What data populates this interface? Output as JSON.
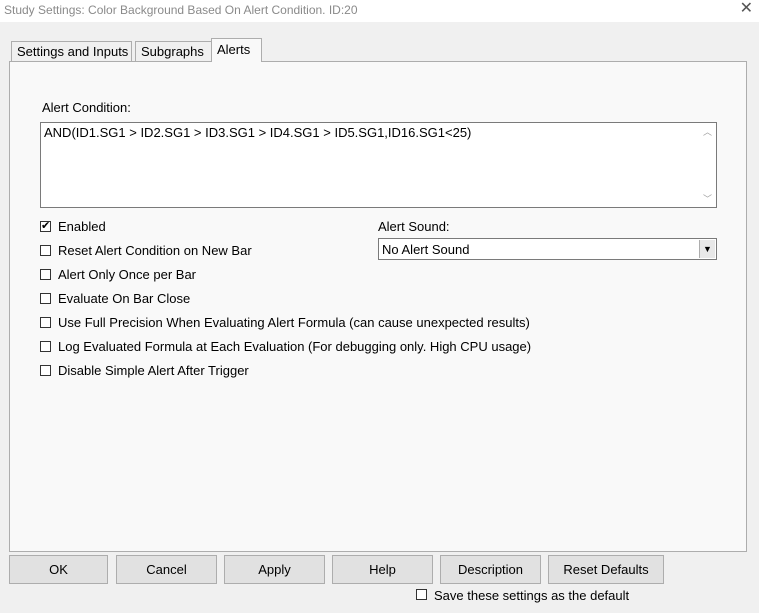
{
  "window": {
    "title": "Study Settings: Color Background Based On Alert Condition. ID:20"
  },
  "tabs": [
    {
      "label": "Settings and Inputs"
    },
    {
      "label": "Subgraphs"
    },
    {
      "label": "Alerts"
    }
  ],
  "alerts": {
    "condition_label": "Alert Condition:",
    "condition_value": "AND(ID1.SG1 > ID2.SG1 > ID3.SG1 > ID4.SG1 > ID5.SG1,ID16.SG1<25)",
    "checkboxes": [
      {
        "label": "Enabled",
        "checked": true
      },
      {
        "label": "Reset Alert Condition on New Bar",
        "checked": false
      },
      {
        "label": "Alert Only Once per Bar",
        "checked": false
      },
      {
        "label": "Evaluate On Bar Close",
        "checked": false
      },
      {
        "label": "Use Full Precision When Evaluating Alert Formula (can cause unexpected results)",
        "checked": false
      },
      {
        "label": "Log Evaluated Formula at Each Evaluation (For debugging only. High CPU usage)",
        "checked": false
      },
      {
        "label": "Disable Simple Alert After Trigger",
        "checked": false
      }
    ],
    "sound_label": "Alert Sound:",
    "sound_value": "No Alert Sound"
  },
  "buttons": {
    "ok": "OK",
    "cancel": "Cancel",
    "apply": "Apply",
    "help": "Help",
    "description": "Description",
    "reset_defaults": "Reset Defaults"
  },
  "footer": {
    "save_default_label": "Save these settings as the default",
    "save_default_checked": false
  }
}
